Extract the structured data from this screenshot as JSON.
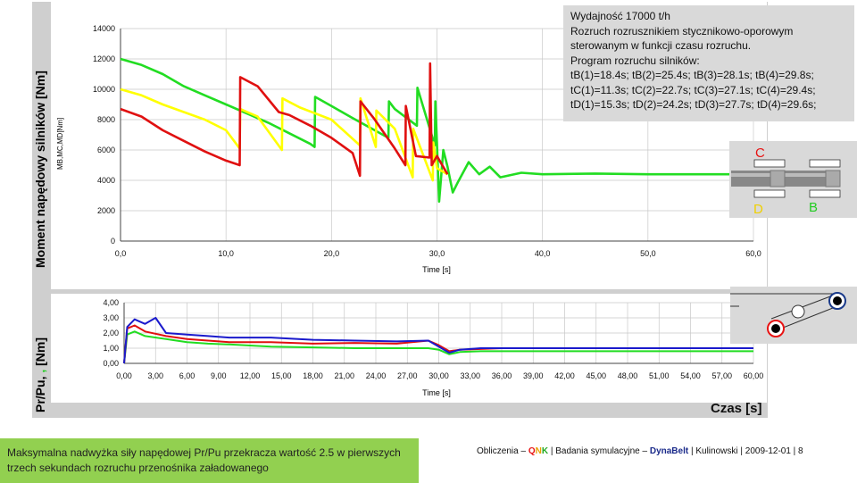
{
  "top_chart": {
    "ylabel": "Moment napędowy silników [Nm]",
    "inner_ylabel": "MB,MC,MD[Nm]",
    "xlabel": "Time [s]"
  },
  "bottom_chart": {
    "ylabel_parts": [
      "Pr/Pu, ",
      "  ,  ",
      " [Nm]"
    ],
    "xlabel": "Time [s]",
    "axis_title": "Czas [s]"
  },
  "info": {
    "lines": [
      "Wydajność 17000 t/h",
      "Rozruch rozrusznikiem stycznikowo-oporowym",
      "sterowanym w funkcji czasu rozruchu.",
      "Program rozruchu silników:",
      "tB(1)=18.4s; tB(2)=25.4s; tB(3)=28.1s; tB(4)=29.8s;",
      "tC(1)=11.3s; tC(2)=22.7s; tC(3)=27.1s; tC(4)=29.4s;",
      "tD(1)=15.3s; tD(2)=24.2s; tD(3)=27.7s; tD(4)=29.6s;"
    ]
  },
  "diagram": {
    "label_c": "C",
    "label_d": "D",
    "label_b": "B",
    "color_c": "#e81313",
    "color_d": "#f0d000",
    "color_b": "#22cc22"
  },
  "note": "Maksymalna nadwyżka siły napędowej Pr/Pu przekracza wartość 2.5 w pierwszych trzech sekundach rozruchu przenośnika załadowanego",
  "footer": {
    "prefix": "Obliczenia – ",
    "qnk_q": "Q",
    "qnk_n": "N",
    "qnk_k": "K",
    "mid": " | Badania symulacyjne – ",
    "dynabelt": "DynaBelt",
    "suffix": " | Kulinowski | 2009-12-01 | 8"
  },
  "chart_data": [
    {
      "type": "line",
      "xlabel": "Time [s]",
      "ylabel": "MB,MC,MD[Nm]",
      "xlim": [
        0,
        60
      ],
      "ylim": [
        0,
        14000
      ],
      "xticks": [
        "0,0",
        "10,0",
        "20,0",
        "30,0",
        "40,0",
        "50,0",
        "60,0"
      ],
      "yticks": [
        "0",
        "2000",
        "4000",
        "6000",
        "8000",
        "10000",
        "12000",
        "14000"
      ],
      "grid": true,
      "series": [
        {
          "color": "#22dd22",
          "x": [
            0,
            2,
            4,
            6,
            8,
            10,
            12,
            14,
            16,
            18,
            18.4,
            18.45,
            20,
            22,
            25.4,
            25.45,
            26,
            28.1,
            28.15,
            29.8,
            29.85,
            30.2,
            30.6,
            31,
            31.5,
            32,
            33,
            34,
            35,
            36,
            38,
            40,
            45,
            50,
            55,
            60
          ],
          "y": [
            12000,
            11600,
            11000,
            10200,
            9600,
            9000,
            8400,
            7800,
            7100,
            6400,
            6200,
            9500,
            8900,
            8100,
            6800,
            9200,
            8700,
            7600,
            10100,
            6300,
            9200,
            2600,
            6000,
            4900,
            3200,
            3900,
            5200,
            4400,
            4900,
            4200,
            4500,
            4400,
            4450,
            4400,
            4400,
            4400
          ]
        },
        {
          "color": "#ffff00",
          "x": [
            0,
            2,
            4,
            6,
            8,
            10,
            11.3,
            11.35,
            13,
            15.3,
            15.35,
            17,
            20,
            22.7,
            22.75,
            24.2,
            24.25,
            26,
            27.7,
            27.75,
            29.6,
            29.65,
            30,
            31
          ],
          "y": [
            10000,
            9600,
            9000,
            8500,
            8000,
            7300,
            6100,
            8700,
            8200,
            6000,
            9400,
            8800,
            8000,
            6300,
            9400,
            6200,
            8600,
            7400,
            4200,
            7400,
            4000,
            6500,
            4800,
            4400
          ]
        },
        {
          "color": "#e01010",
          "x": [
            0,
            2,
            4,
            6,
            8,
            10,
            11.3,
            11.35,
            13,
            15,
            16,
            18,
            20,
            22,
            22.7,
            22.75,
            24,
            26,
            27,
            27.05,
            28,
            29.3,
            29.35,
            29.5,
            30,
            31
          ],
          "y": [
            8700,
            8200,
            7300,
            6600,
            5900,
            5300,
            5000,
            10800,
            10200,
            8500,
            8300,
            7600,
            6800,
            5800,
            4300,
            9200,
            8100,
            6100,
            5000,
            8900,
            5600,
            5500,
            11700,
            5000,
            5600,
            4400
          ]
        }
      ]
    },
    {
      "type": "line",
      "xlabel": "Time [s]",
      "xlim": [
        0,
        60
      ],
      "ylim": [
        0,
        4
      ],
      "xticks": [
        "0,00",
        "3,00",
        "6,00",
        "9,00",
        "12,00",
        "15,00",
        "18,00",
        "21,00",
        "24,00",
        "27,00",
        "30,00",
        "33,00",
        "36,00",
        "39,00",
        "42,00",
        "45,00",
        "48,00",
        "51,00",
        "54,00",
        "57,00",
        "60,00"
      ],
      "yticks": [
        "0,00",
        "1,00",
        "2,00",
        "3,00",
        "4,00"
      ],
      "grid": true,
      "series": [
        {
          "color": "#22dd22",
          "x": [
            0,
            0.3,
            1,
            2,
            4,
            6,
            8,
            10,
            14,
            18,
            22,
            26,
            29,
            30,
            31,
            32,
            34,
            36,
            40,
            50,
            60
          ],
          "y": [
            0,
            1.9,
            2.1,
            1.8,
            1.6,
            1.4,
            1.3,
            1.25,
            1.1,
            1.05,
            1.0,
            1.0,
            1.0,
            0.9,
            0.6,
            0.75,
            0.8,
            0.8,
            0.8,
            0.8,
            0.8
          ]
        },
        {
          "color": "#e01010",
          "x": [
            0,
            0.3,
            1,
            2,
            4,
            6,
            8,
            10,
            14,
            18,
            22,
            26,
            29,
            30,
            31,
            32,
            34,
            36,
            40,
            50,
            60
          ],
          "y": [
            0,
            2.3,
            2.5,
            2.1,
            1.8,
            1.6,
            1.5,
            1.4,
            1.4,
            1.3,
            1.35,
            1.3,
            1.5,
            1.2,
            0.8,
            0.9,
            0.95,
            1.0,
            1.0,
            1.0,
            1.0
          ]
        },
        {
          "color": "#1a1acc",
          "x": [
            0,
            0.3,
            1,
            2,
            3,
            4,
            6,
            8,
            10,
            14,
            18,
            22,
            26,
            29,
            30,
            31,
            32,
            34,
            36,
            40,
            50,
            60
          ],
          "y": [
            0,
            2.4,
            2.9,
            2.6,
            3.0,
            2.0,
            1.9,
            1.8,
            1.7,
            1.7,
            1.55,
            1.5,
            1.45,
            1.5,
            1.1,
            0.7,
            0.9,
            1.0,
            1.0,
            1.0,
            1.0,
            1.0
          ]
        }
      ]
    }
  ]
}
